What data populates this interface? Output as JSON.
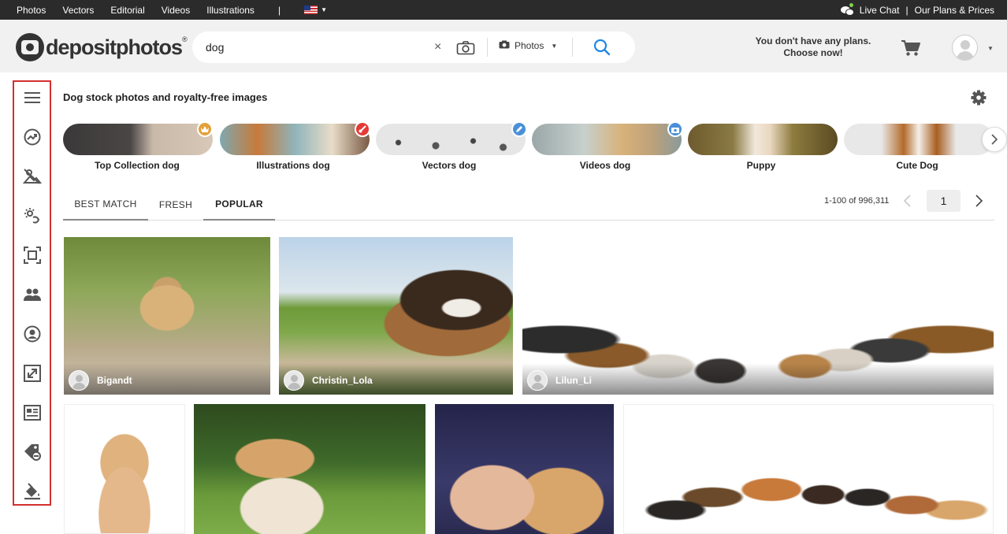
{
  "topbar": {
    "nav": [
      "Photos",
      "Vectors",
      "Editorial",
      "Videos",
      "Illustrations"
    ],
    "separator": "|",
    "flag_icon": "us-flag-icon",
    "live_chat": "Live Chat",
    "pipe": "|",
    "plans_prices": "Our Plans & Prices"
  },
  "header": {
    "logo_text": "depositphotos",
    "logo_reg": "®",
    "search": {
      "value": "dog",
      "clear": "×",
      "content_type": "Photos"
    },
    "plans_line1": "You don't have any plans.",
    "plans_line2": "Choose now!"
  },
  "sidebar": {
    "icons": [
      "menu-icon",
      "trending-icon",
      "no-background-icon",
      "magic-edit-icon",
      "crop-frame-icon",
      "people-icon",
      "user-circle-icon",
      "expand-icon",
      "article-icon",
      "sale-tag-icon",
      "paint-bucket-icon"
    ]
  },
  "main": {
    "title": "Dog stock photos and royalty-free images",
    "categories": [
      {
        "label": "Top Collection dog",
        "badge": "crown",
        "badge_color": "#e2a13a"
      },
      {
        "label": "Illustrations dog",
        "badge": "brush",
        "badge_color": "#e53935"
      },
      {
        "label": "Vectors dog",
        "badge": "pen",
        "badge_color": "#4a90d9"
      },
      {
        "label": "Videos dog",
        "badge": "camera",
        "badge_color": "#4a90d9"
      },
      {
        "label": "Puppy",
        "badge": "",
        "badge_color": ""
      },
      {
        "label": "Cute Dog",
        "badge": "",
        "badge_color": ""
      }
    ],
    "tabs": [
      "BEST MATCH",
      "FRESH",
      "POPULAR"
    ],
    "active_tab": "POPULAR",
    "results_count": "1-100 of 996,311",
    "page": "1",
    "photos": [
      {
        "author": "Bigandt"
      },
      {
        "author": "Christin_Lola"
      },
      {
        "author": "Lilun_Li"
      },
      {
        "author": ""
      },
      {
        "author": ""
      },
      {
        "author": ""
      },
      {
        "author": ""
      }
    ]
  },
  "colors": {
    "accent_blue": "#1e88e5",
    "sidebar_border": "#d32f2f",
    "topbar_bg": "#2b2b2b",
    "header_bg": "#f1f1f1"
  }
}
